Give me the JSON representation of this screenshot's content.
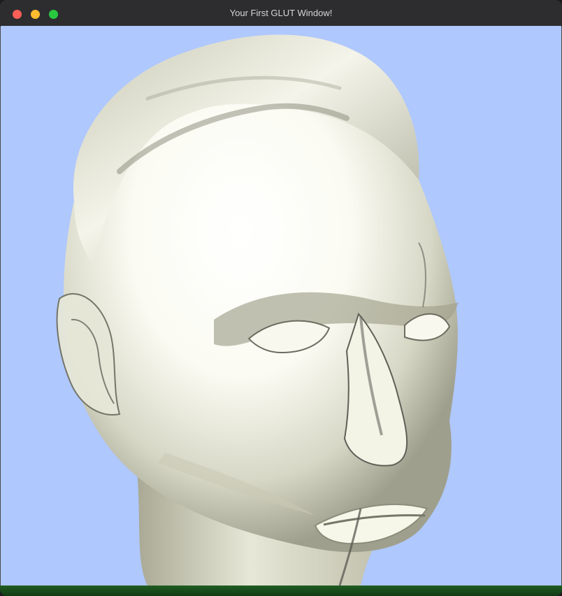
{
  "window": {
    "title": "Your First GLUT Window!",
    "controls": [
      {
        "name": "close",
        "color": "#ff5f57"
      },
      {
        "name": "minimize",
        "color": "#febc2e"
      },
      {
        "name": "zoom",
        "color": "#28c840"
      }
    ]
  },
  "scene": {
    "background_color": "#afc8fd",
    "model_color": "#f1f1e3",
    "shadow_color": "#9c9c8a",
    "subject": "rendered 3D head mesh"
  }
}
